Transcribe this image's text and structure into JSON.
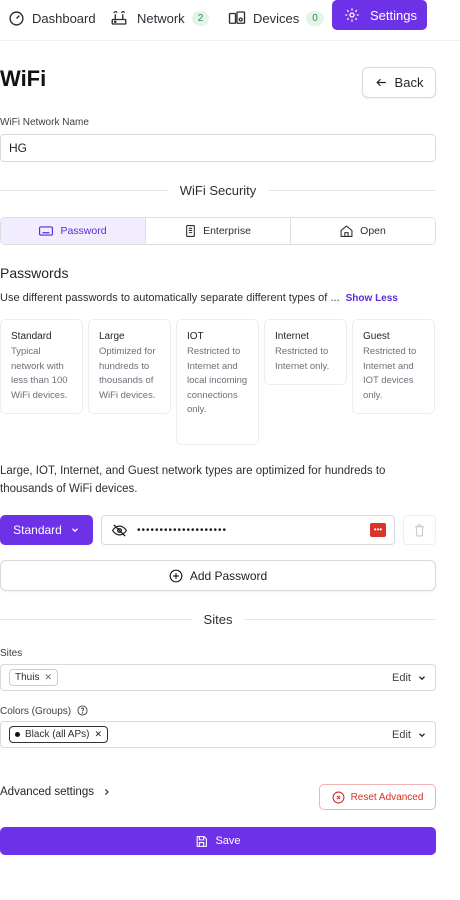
{
  "nav": {
    "dashboard_label": "Dashboard",
    "network_label": "Network",
    "network_count": "2",
    "devices_label": "Devices",
    "devices_count": "0",
    "settings_label": "Settings"
  },
  "page": {
    "title": "WiFi",
    "back_label": "Back"
  },
  "network_name": {
    "label": "WiFi Network Name",
    "value": "HG"
  },
  "security": {
    "heading": "WiFi Security",
    "options": [
      {
        "label": "Password",
        "icon": "keyboard-icon",
        "active": true
      },
      {
        "label": "Enterprise",
        "icon": "building-icon",
        "active": false
      },
      {
        "label": "Open",
        "icon": "home-icon",
        "active": false
      }
    ]
  },
  "passwords": {
    "title": "Passwords",
    "description": "Use different passwords to automatically separate different types of ...",
    "show_less": "Show Less",
    "types": [
      {
        "name": "Standard",
        "desc": "Typical network with less than 100 WiFi devices."
      },
      {
        "name": "Large",
        "desc": "Optimized for hundreds to thousands of WiFi devices."
      },
      {
        "name": "IOT",
        "desc": "Restricted to Internet and local incoming connections only."
      },
      {
        "name": "Internet",
        "desc": "Restricted to Internet only."
      },
      {
        "name": "Guest",
        "desc": "Restricted to Internet and IOT devices only."
      }
    ],
    "note": "Large, IOT, Internet, and Guest network types are optimized for hundreds to thousands of WiFi devices.",
    "entry": {
      "type": "Standard",
      "masked_value": "••••••••••••••••••••"
    },
    "add_label": "Add Password"
  },
  "sites": {
    "heading": "Sites",
    "label": "Sites",
    "chips": [
      "Thuis"
    ],
    "edit_label": "Edit"
  },
  "colors": {
    "label": "Colors (Groups)",
    "chips": [
      "Black (all APs)"
    ],
    "chip_dot_color": "#111111",
    "edit_label": "Edit"
  },
  "advanced": {
    "label": "Advanced settings",
    "reset_label": "Reset Advanced"
  },
  "save_label": "Save",
  "colors_theme": {
    "accent": "#6d32e8",
    "danger": "#d42f28",
    "badge_bg": "#e3f5e9",
    "badge_fg": "#2d8a4f"
  }
}
